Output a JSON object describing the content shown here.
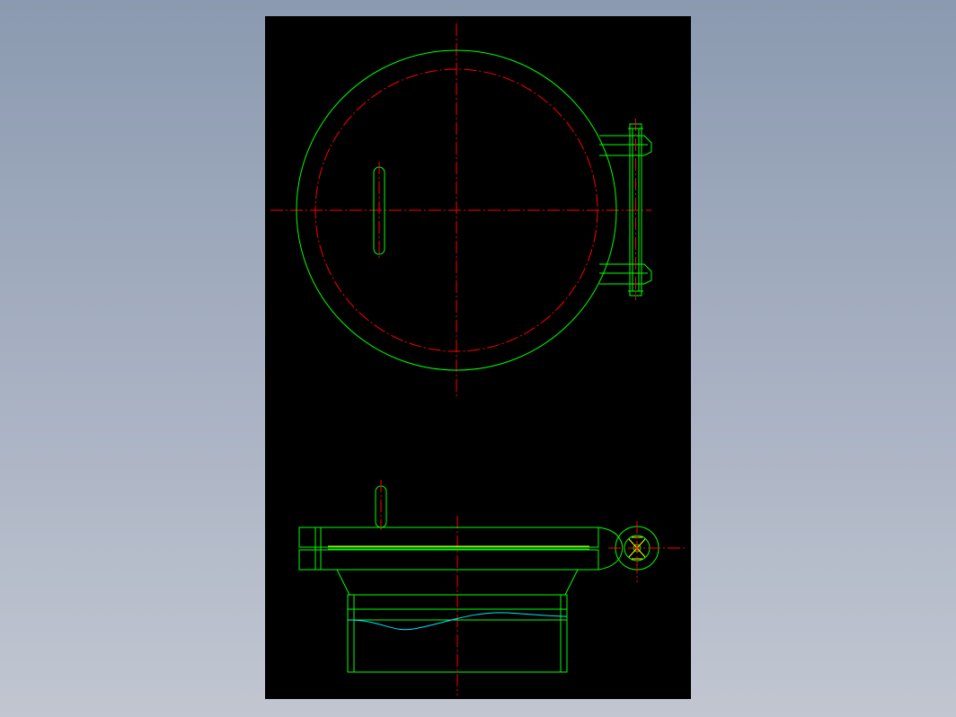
{
  "viewer": {
    "background_colors": [
      "#8b9ab0",
      "#c1c6d1"
    ],
    "sheet_color": "#000000"
  },
  "drawing": {
    "title": "",
    "views": [
      "top-view",
      "side-view"
    ],
    "layer_colors": {
      "outline": "#00ff00",
      "centerline": "#ff0000",
      "break_line": "#00e5ff",
      "hidden_detail": "#ffff00"
    },
    "centerline_style": "dash-dot",
    "annotations": []
  }
}
